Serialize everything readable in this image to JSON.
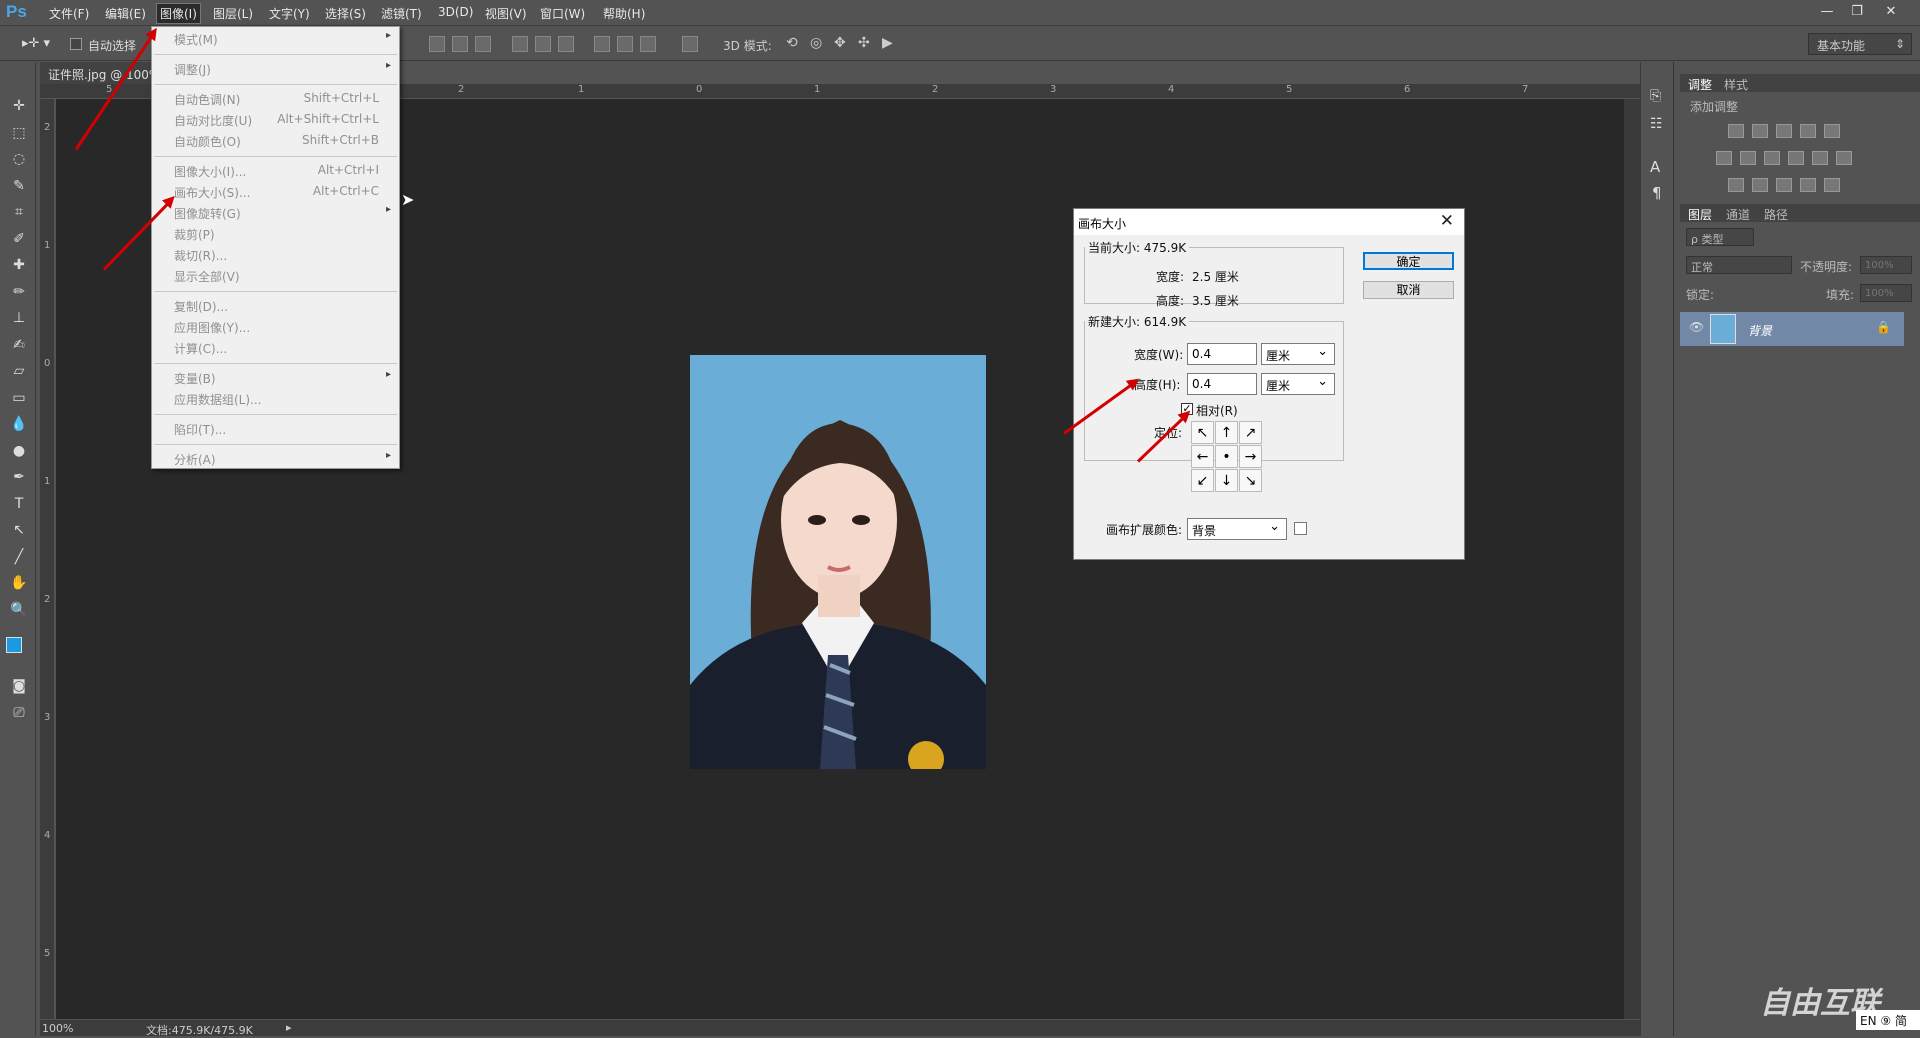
{
  "app": {
    "logo": "Ps"
  },
  "menubar": {
    "items": [
      "文件(F)",
      "编辑(E)",
      "图像(I)",
      "图层(L)",
      "文字(Y)",
      "选择(S)",
      "滤镜(T)",
      "3D(D)",
      "视图(V)",
      "窗口(W)",
      "帮助(H)"
    ],
    "active": "图像(I)"
  },
  "window_controls": {
    "minimize": "—",
    "restore": "❐",
    "close": "✕"
  },
  "options_bar": {
    "auto_select_label": "自动选择",
    "mode_3d_label": "3D 模式:",
    "workspace": "基本功能"
  },
  "document": {
    "tab_title": "证件照.jpg @ 100%"
  },
  "ruler": {
    "h_labels": [
      "5",
      "2",
      "1",
      "0",
      "1",
      "2",
      "3",
      "4",
      "5",
      "6",
      "7"
    ],
    "v_labels": [
      "2",
      "1",
      "0",
      "1",
      "2",
      "3",
      "4",
      "5"
    ]
  },
  "status": {
    "zoom": "100%",
    "doc_info": "文档:475.9K/475.9K"
  },
  "image_menu": {
    "groups": [
      [
        {
          "label": "模式(M)",
          "shortcut": "",
          "submenu": true
        }
      ],
      [
        {
          "label": "调整(J)",
          "shortcut": "",
          "submenu": true
        }
      ],
      [
        {
          "label": "自动色调(N)",
          "shortcut": "Shift+Ctrl+L",
          "submenu": false
        },
        {
          "label": "自动对比度(U)",
          "shortcut": "Alt+Shift+Ctrl+L",
          "submenu": false
        },
        {
          "label": "自动颜色(O)",
          "shortcut": "Shift+Ctrl+B",
          "submenu": false
        }
      ],
      [
        {
          "label": "图像大小(I)...",
          "shortcut": "Alt+Ctrl+I",
          "submenu": false
        },
        {
          "label": "画布大小(S)...",
          "shortcut": "Alt+Ctrl+C",
          "submenu": false
        },
        {
          "label": "图像旋转(G)",
          "shortcut": "",
          "submenu": true
        },
        {
          "label": "裁剪(P)",
          "shortcut": "",
          "submenu": false
        },
        {
          "label": "裁切(R)...",
          "shortcut": "",
          "submenu": false
        },
        {
          "label": "显示全部(V)",
          "shortcut": "",
          "submenu": false
        }
      ],
      [
        {
          "label": "复制(D)...",
          "shortcut": "",
          "submenu": false
        },
        {
          "label": "应用图像(Y)...",
          "shortcut": "",
          "submenu": false
        },
        {
          "label": "计算(C)...",
          "shortcut": "",
          "submenu": false
        }
      ],
      [
        {
          "label": "变量(B)",
          "shortcut": "",
          "submenu": true
        },
        {
          "label": "应用数据组(L)...",
          "shortcut": "",
          "submenu": false
        }
      ],
      [
        {
          "label": "陷印(T)...",
          "shortcut": "",
          "submenu": false
        }
      ],
      [
        {
          "label": "分析(A)",
          "shortcut": "",
          "submenu": true
        }
      ]
    ]
  },
  "canvas_dialog": {
    "title": "画布大小",
    "current_size_legend": "当前大小: 475.9K",
    "current_width_label": "宽度:",
    "current_width_value": "2.5 厘米",
    "current_height_label": "高度:",
    "current_height_value": "3.5 厘米",
    "new_size_legend": "新建大小: 614.9K",
    "width_label": "宽度(W):",
    "width_value": "0.4",
    "width_unit": "厘米",
    "height_label": "高度(H):",
    "height_value": "0.4",
    "height_unit": "厘米",
    "relative_label": "相对(R)",
    "relative_checked": true,
    "anchor_label": "定位:",
    "extension_color_label": "画布扩展颜色:",
    "extension_color_value": "背景",
    "ok_button": "确定",
    "cancel_button": "取消"
  },
  "right_panel": {
    "adjust_tabs": [
      "调整",
      "样式"
    ],
    "add_adjustment": "添加调整",
    "layers_tabs": [
      "图层",
      "通道",
      "路径"
    ],
    "kind_filter": "ρ 类型",
    "blend_mode": "正常",
    "opacity_label": "不透明度:",
    "opacity_value": "100%",
    "lock_label": "锁定:",
    "fill_label": "填充:",
    "fill_value": "100%",
    "layer_name": "背景"
  },
  "watermark": {
    "text": "自由互联",
    "ime": "EN ⑨ 简"
  },
  "colors": {
    "bg": "#535353",
    "canvas": "#282828",
    "photo_bg": "#6aaed8",
    "annotation": "#d20000",
    "accent": "#0078d7"
  }
}
